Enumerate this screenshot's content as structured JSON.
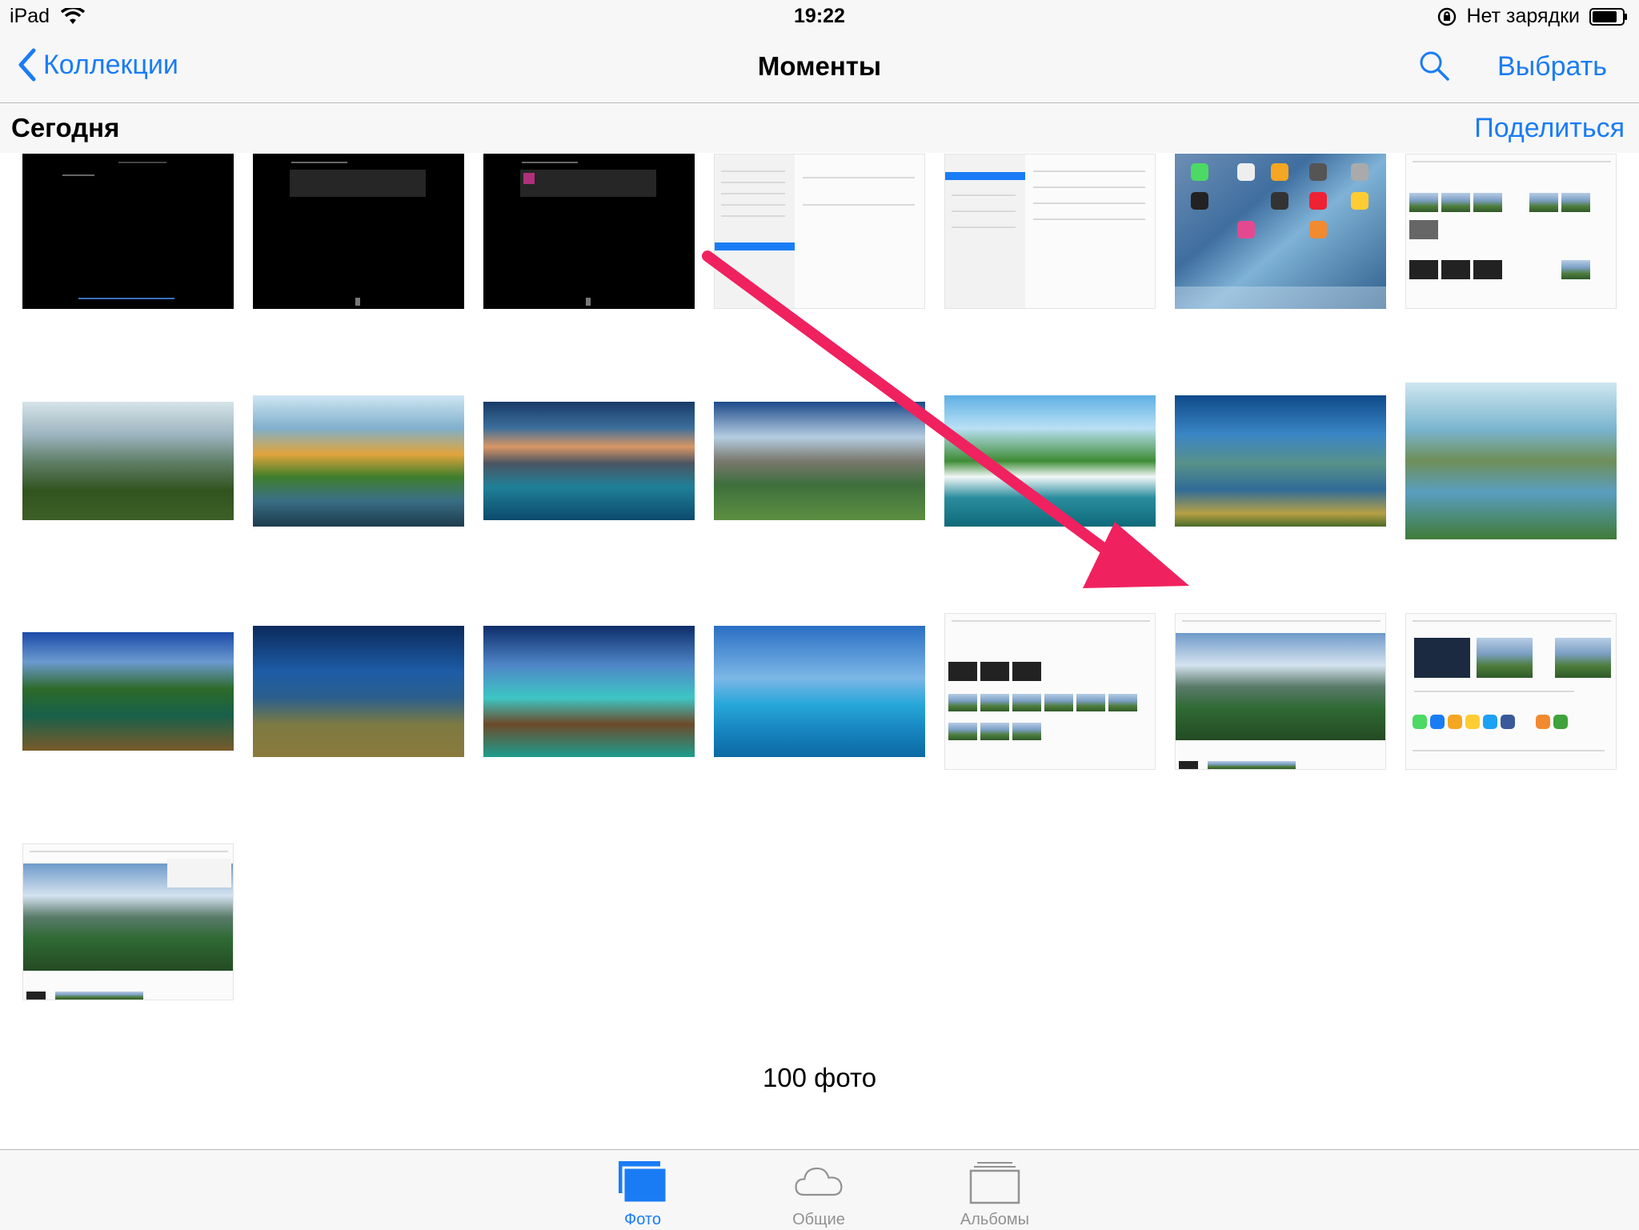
{
  "status_bar": {
    "device": "iPad",
    "time": "19:22",
    "charging_text": "Нет зарядки"
  },
  "nav": {
    "back_label": "Коллекции",
    "title": "Моменты",
    "select_label": "Выбрать"
  },
  "section": {
    "title": "Сегодня",
    "share_label": "Поделиться"
  },
  "photos": {
    "count_text": "100 фото"
  },
  "tabs": {
    "photos": "Фото",
    "shared": "Общие",
    "albums": "Альбомы"
  },
  "colors": {
    "accent": "#1a7cf5",
    "arrow": "#f0215f",
    "inactive": "#929292"
  },
  "icons": [
    "back-chevron-icon",
    "wifi-icon",
    "lock-rotation-icon",
    "battery-icon",
    "search-icon",
    "photos-tab-icon",
    "cloud-icon",
    "albums-tab-icon",
    "arrow-annotation"
  ]
}
